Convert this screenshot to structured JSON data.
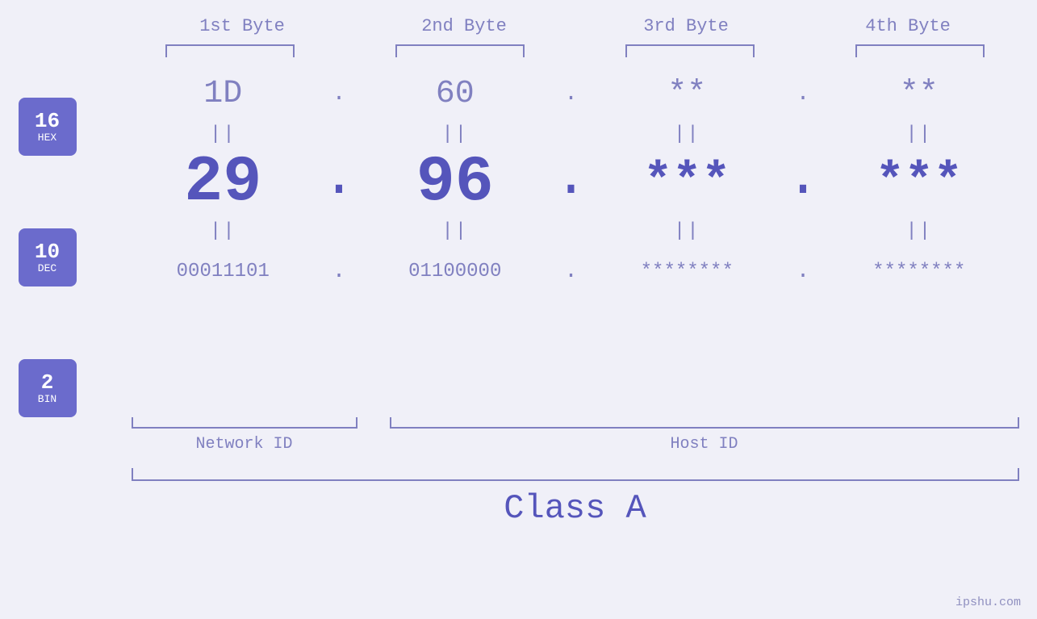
{
  "headers": {
    "byte1": "1st Byte",
    "byte2": "2nd Byte",
    "byte3": "3rd Byte",
    "byte4": "4th Byte"
  },
  "badges": {
    "hex": {
      "num": "16",
      "label": "HEX"
    },
    "dec": {
      "num": "10",
      "label": "DEC"
    },
    "bin": {
      "num": "2",
      "label": "BIN"
    }
  },
  "bytes": [
    {
      "hex": "1D",
      "dec": "29",
      "bin": "00011101"
    },
    {
      "hex": "60",
      "dec": "96",
      "bin": "01100000"
    },
    {
      "hex": "**",
      "dec": "***",
      "bin": "********"
    },
    {
      "hex": "**",
      "dec": "***",
      "bin": "********"
    }
  ],
  "labels": {
    "network_id": "Network ID",
    "host_id": "Host ID",
    "class": "Class A"
  },
  "watermark": "ipshu.com"
}
